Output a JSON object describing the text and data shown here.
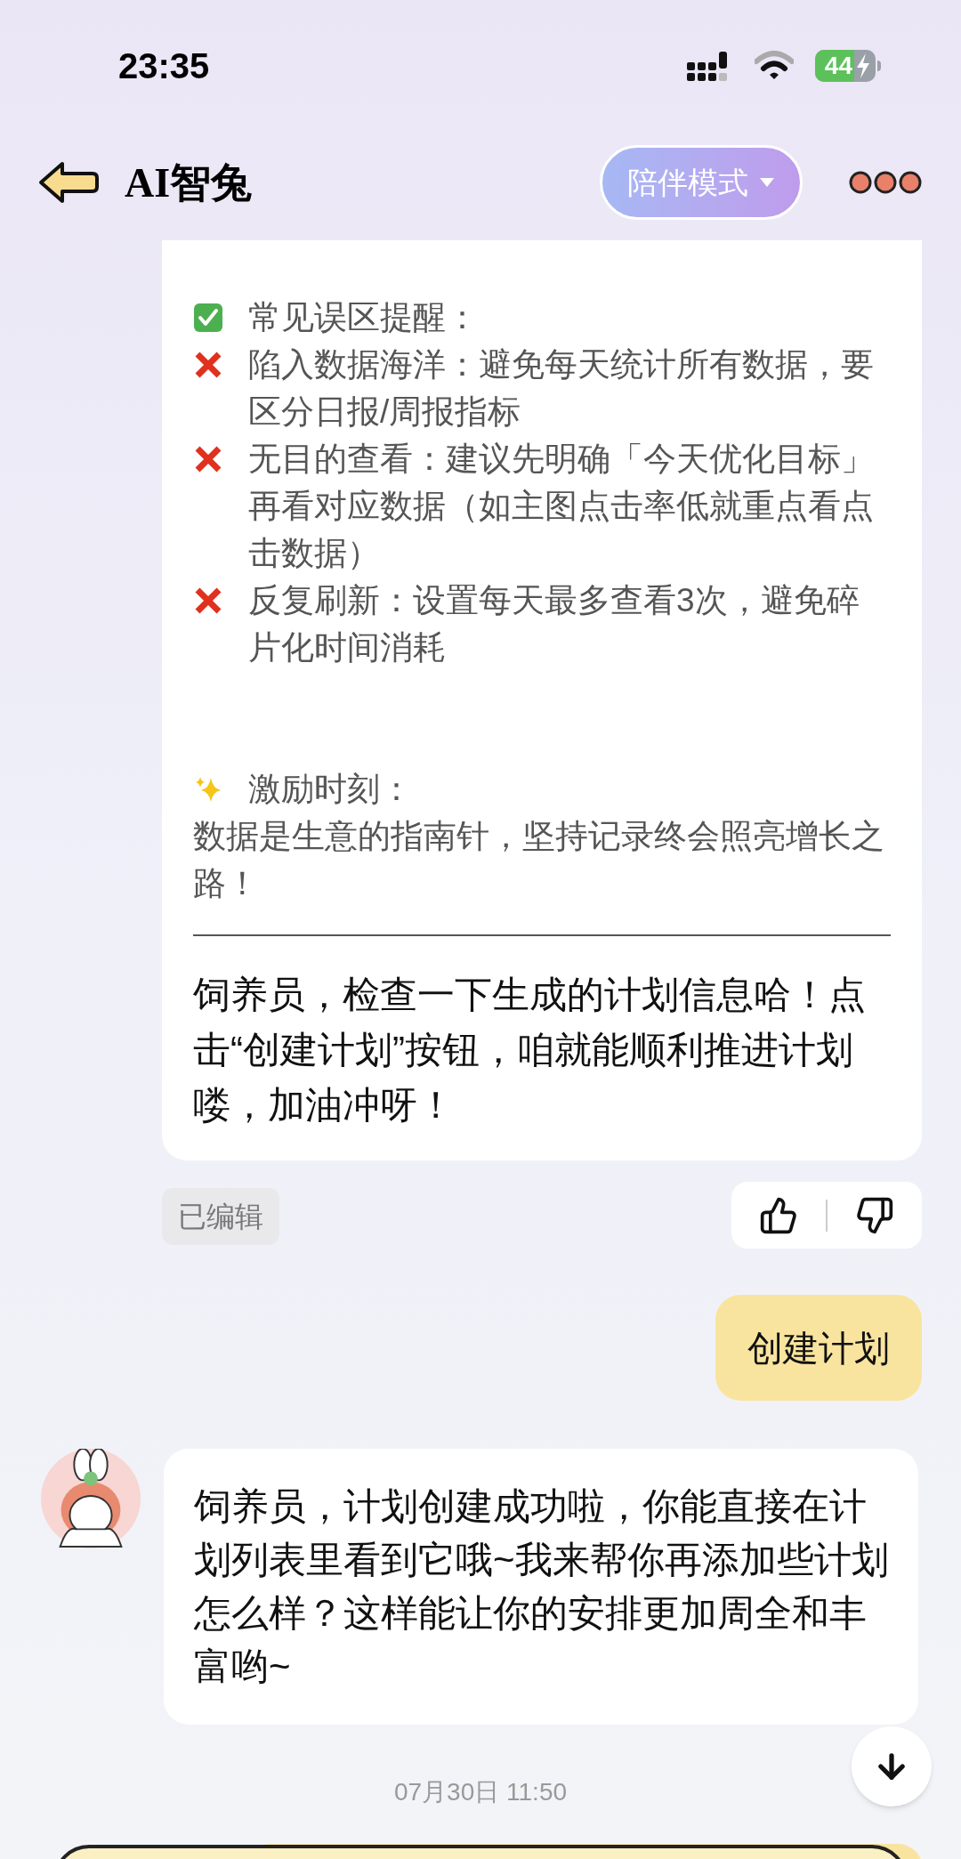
{
  "status_bar": {
    "time": "23:35",
    "battery": "44"
  },
  "header": {
    "title": "AI智兔",
    "mode_button": "陪伴模式"
  },
  "tips_card": {
    "items": [
      {
        "kind": "check",
        "text": "常见误区提醒："
      },
      {
        "kind": "cross",
        "text": "陷入数据海洋：避免每天统计所有数据，要区分日报/周报指标"
      },
      {
        "kind": "cross",
        "text": "无目的查看：建议先明确「今天优化目标」再看对应数据（如主图点击率低就重点看点击数据）"
      },
      {
        "kind": "cross",
        "text": "反复刷新：设置每天最多查看3次，避免碎片化时间消耗"
      },
      {
        "kind": "gap"
      },
      {
        "kind": "sparkle",
        "text": "激励时刻："
      },
      {
        "kind": "plain",
        "text": "数据是生意的指南针，坚持记录终会照亮增长之路！"
      }
    ],
    "footer": "饲养员，检查一下生成的计划信息哈！点击“创建计划”按钮，咱就能顺利推进计划喽，加油冲呀！",
    "edited_tag": "已编辑"
  },
  "user_message": "创建计划",
  "bot_message": "饲养员，计划创建成功啦，你能直接在计划列表里看到它哦~我来帮你再添加些计划怎么样？这样能让你的安排更加周全和丰富哟~",
  "timestamp": "07月30日 11:50"
}
